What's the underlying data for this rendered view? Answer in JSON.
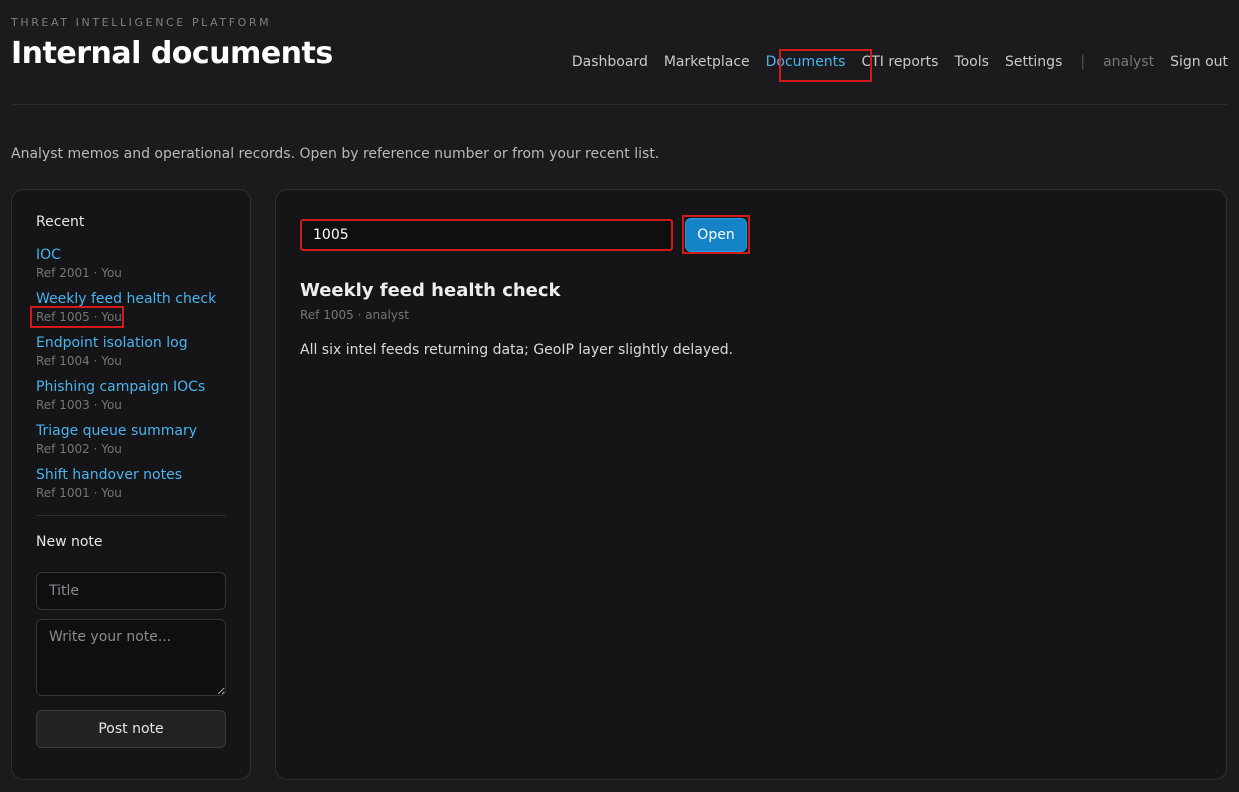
{
  "header": {
    "eyebrow": "THREAT INTELLIGENCE PLATFORM",
    "title": "Internal documents"
  },
  "nav": {
    "items": [
      {
        "label": "Dashboard"
      },
      {
        "label": "Marketplace"
      },
      {
        "label": "Documents",
        "active": true
      },
      {
        "label": "CTI reports"
      },
      {
        "label": "Tools"
      },
      {
        "label": "Settings"
      }
    ],
    "separator": "|",
    "user": "analyst",
    "sign_out": "Sign out"
  },
  "intro": "Analyst memos and operational records. Open by reference number or from your recent list.",
  "sidebar": {
    "recent_heading": "Recent",
    "recent": [
      {
        "title": "IOC",
        "meta": "Ref 2001 · You"
      },
      {
        "title": "Weekly feed health check",
        "meta": "Ref 1005 · You"
      },
      {
        "title": "Endpoint isolation log",
        "meta": "Ref 1004 · You"
      },
      {
        "title": "Phishing campaign IOCs",
        "meta": "Ref 1003 · You"
      },
      {
        "title": "Triage queue summary",
        "meta": "Ref 1002 · You"
      },
      {
        "title": "Shift handover notes",
        "meta": "Ref 1001 · You"
      }
    ],
    "new_note": {
      "heading": "New note",
      "title_placeholder": "Title",
      "body_placeholder": "Write your note...",
      "post_label": "Post note"
    }
  },
  "main": {
    "ref_value": "1005",
    "open_label": "Open",
    "document": {
      "title": "Weekly feed health check",
      "meta": "Ref 1005 · analyst",
      "body": "All six intel feeds returning data; GeoIP layer slightly delayed."
    }
  },
  "colors": {
    "background": "#1b1b1d",
    "accent": "#4ab3ee",
    "primary_button": "#1483c8",
    "highlight": "#d11a1a"
  }
}
